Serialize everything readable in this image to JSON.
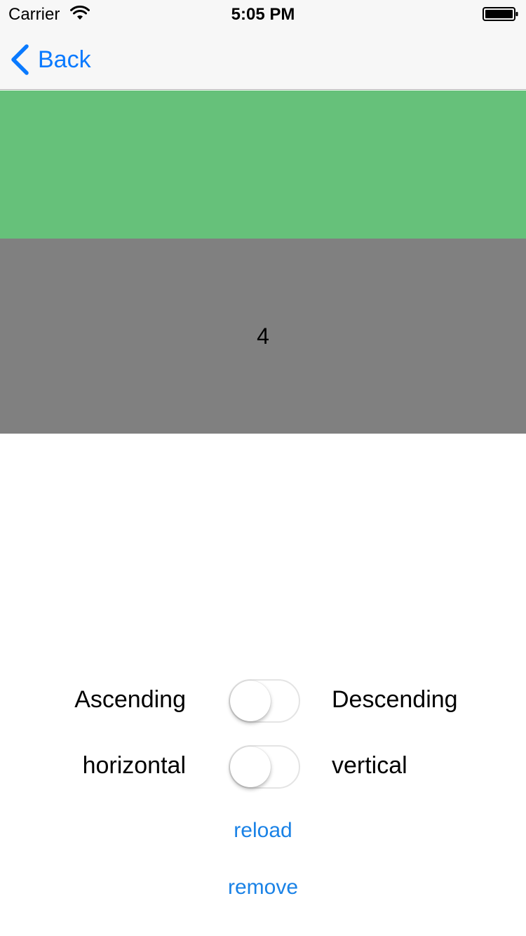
{
  "status_bar": {
    "carrier": "Carrier",
    "time": "5:05 PM",
    "icons": [
      "wifi-icon",
      "battery-icon"
    ]
  },
  "nav": {
    "back_label": "Back",
    "accent_color": "#0a7aff"
  },
  "content": {
    "green_block_color": "#66c17a",
    "grey_block_color": "#808080",
    "grey_block_text": "4"
  },
  "controls": {
    "order": {
      "left_label": "Ascending",
      "right_label": "Descending",
      "switch_on": false
    },
    "direction": {
      "left_label": "horizontal",
      "right_label": "vertical",
      "switch_on": false
    },
    "reload_label": "reload",
    "remove_label": "remove",
    "link_color": "#1a82e6"
  }
}
